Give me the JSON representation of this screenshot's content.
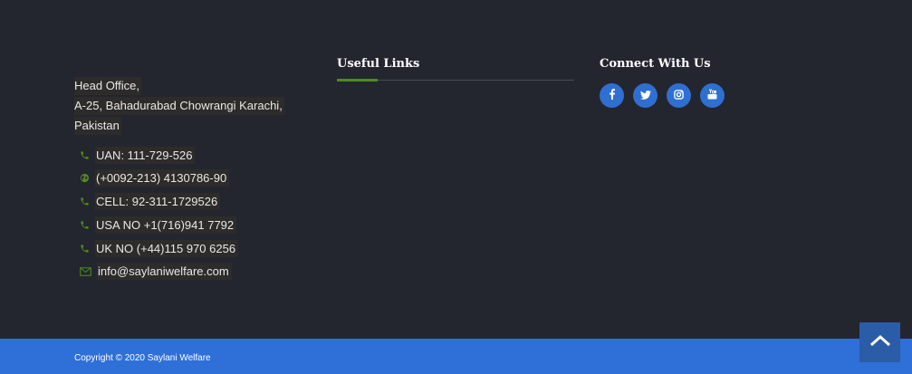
{
  "address": {
    "lines": [
      "Head Office,",
      "A-25, Bahadurabad Chowrangi Karachi,",
      "Pakistan"
    ]
  },
  "contacts": [
    {
      "icon": "phone-icon",
      "text": "UAN: 111-729-526"
    },
    {
      "icon": "globe-icon",
      "text": "(+0092-213) 4130786-90"
    },
    {
      "icon": "phone-icon",
      "text": "CELL: 92-311-1729526"
    },
    {
      "icon": "phone-icon",
      "text": "USA NO +1(716)941 7792"
    },
    {
      "icon": "phone-icon",
      "text": "UK NO (+44)115 970 6256"
    },
    {
      "icon": "envelope-icon",
      "text": "info@saylaniwelfare.com"
    }
  ],
  "useful_links": {
    "heading": "Useful Links"
  },
  "connect": {
    "heading": "Connect With Us",
    "social": [
      "facebook-icon",
      "twitter-icon",
      "instagram-icon",
      "youtube-icon"
    ]
  },
  "footer": {
    "copyright": "Copyright © 2020 Saylani Welfare"
  },
  "colors": {
    "background": "#23262e",
    "accent_green": "#4e8b1e",
    "brand_blue": "#2f6fd8"
  }
}
